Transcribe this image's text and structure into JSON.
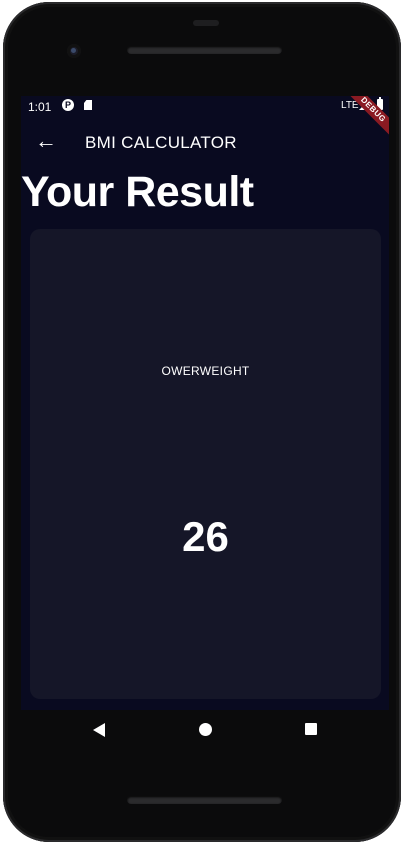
{
  "status_bar": {
    "time": "1:01",
    "network": "LTE",
    "icons": [
      "p-notification-icon",
      "sd-card-icon",
      "signal-icon",
      "battery-icon"
    ]
  },
  "debug_banner": "DEBUG",
  "app_bar": {
    "back_icon": "arrow-back-icon",
    "title": "BMI CALCULATOR"
  },
  "page": {
    "title": "Your Result"
  },
  "result": {
    "status": "OWERWEIGHT",
    "bmi": "26"
  },
  "nav_bar": {
    "icons": [
      "back-triangle-icon",
      "home-circle-icon",
      "recents-square-icon"
    ]
  },
  "colors": {
    "screen_bg": "#090a20",
    "card_bg": "#151628",
    "text": "#ffffff",
    "debug_ribbon": "#8a1a22"
  }
}
